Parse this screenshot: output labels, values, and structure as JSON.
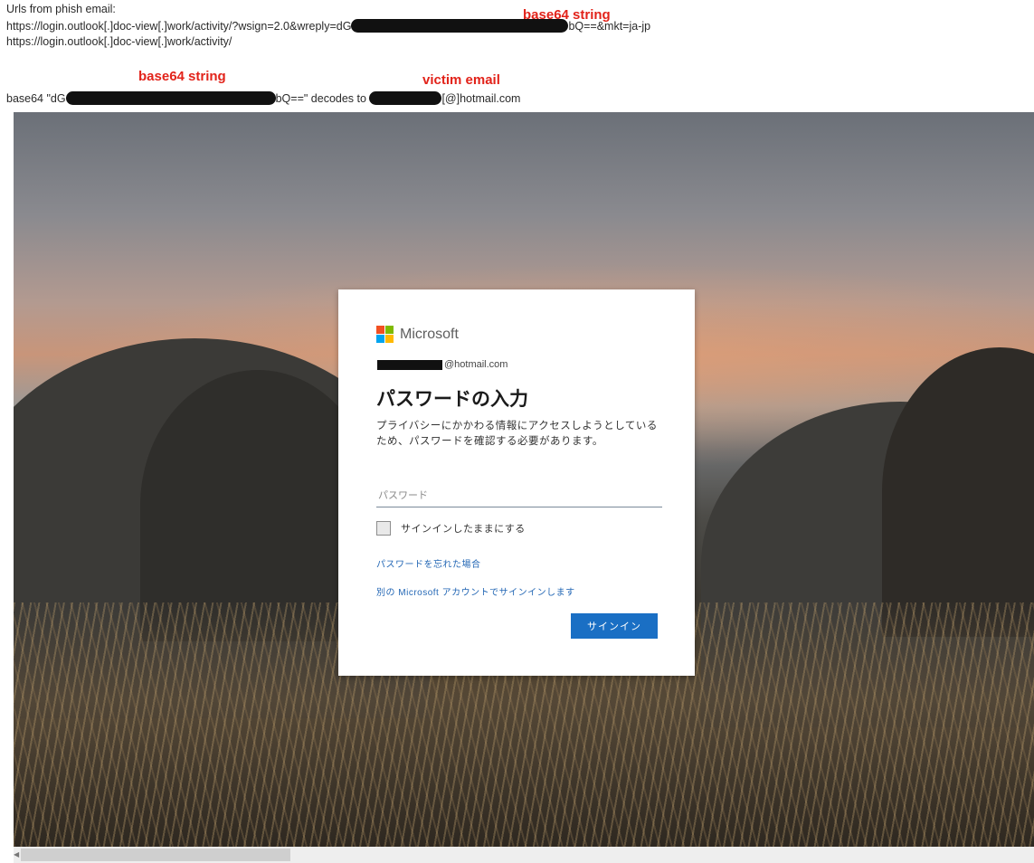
{
  "notes": {
    "line1": "Urls from phish email:",
    "line2_prefix": "https://login.outlook[.]doc-view[.]work/activity/?wsign=2.0&wreply=dG",
    "line2_suffix": "bQ==&mkt=ja-jp",
    "line3": "https://login.outlook[.]doc-view[.]work/activity/",
    "line4_prefix": "base64 \"dG",
    "line4_middle": "bQ==\" decodes to",
    "line4_suffix": "[@]hotmail.com"
  },
  "annotations": {
    "base64_top": "base64 string",
    "base64_bottom": "base64 string",
    "victim_email": "victim email",
    "color": "#e2231a"
  },
  "login": {
    "brand": "Microsoft",
    "account_suffix": "@hotmail.com",
    "title": "パスワードの入力",
    "description": "プライバシーにかかわる情報にアクセスしようとしているため、パスワードを確認する必要があります。",
    "password_placeholder": "パスワード",
    "password_value": "",
    "keep_signed_in": "サインインしたままにする",
    "forgot_link": "パスワードを忘れた場合",
    "other_account_link": "別の Microsoft アカウントでサインインします",
    "signin_button": "サインイン",
    "accent": "#1a6fc4",
    "logo_colors": [
      "#f25022",
      "#7fba00",
      "#00a4ef",
      "#ffb900"
    ]
  }
}
